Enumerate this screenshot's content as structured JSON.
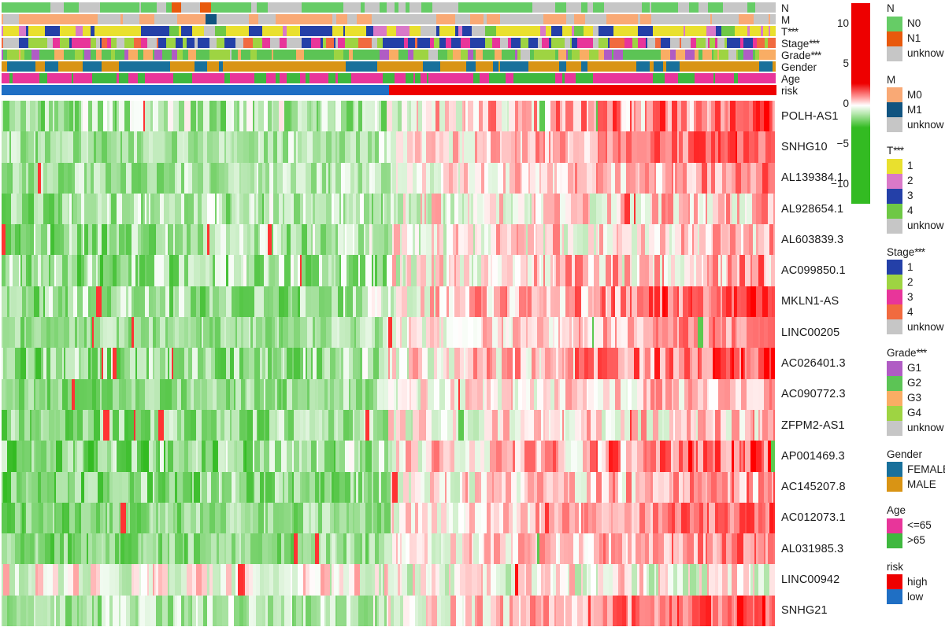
{
  "figure": {
    "type": "heatmap",
    "description": "Clustered expression heatmap of 17 lncRNAs across tumour samples with clinical annotation tracks and risk-group split"
  },
  "annotation_tracks": [
    {
      "name": "N",
      "label": "N",
      "stars": ""
    },
    {
      "name": "M",
      "label": "M",
      "stars": ""
    },
    {
      "name": "T",
      "label": "T",
      "stars": "***"
    },
    {
      "name": "Stage",
      "label": "Stage",
      "stars": "***"
    },
    {
      "name": "Grade",
      "label": "Grade",
      "stars": "***"
    },
    {
      "name": "Gender",
      "label": "Gender",
      "stars": ""
    },
    {
      "name": "Age",
      "label": "Age",
      "stars": ""
    },
    {
      "name": "risk",
      "label": "risk",
      "stars": ""
    }
  ],
  "row_labels": [
    "POLH-AS1",
    "SNHG10",
    "AL139384.1",
    "AL928654.1",
    "AL603839.3",
    "AC099850.1",
    "MKLN1-AS",
    "LINC00205",
    "AC026401.3",
    "AC090772.3",
    "ZFPM2-AS1",
    "AP001469.3",
    "AC145207.8",
    "AC012073.1",
    "AL031985.3",
    "LINC00942",
    "SNHG21"
  ],
  "colorbar": {
    "ticks": [
      "10",
      "5",
      "0",
      "-5",
      "-10"
    ],
    "tick_values": [
      10,
      5,
      0,
      -5,
      -10
    ],
    "min": -12.5,
    "max": 12.5,
    "high_color": "#ee0000",
    "mid_color": "#ffffff",
    "low_color": "#33bb22"
  },
  "legends": [
    {
      "title": "N",
      "stars": "",
      "items": [
        {
          "label": "N0",
          "color": "#66cc66"
        },
        {
          "label": "N1",
          "color": "#e8590c"
        },
        {
          "label": "unknow",
          "color": "#c6c6c6"
        }
      ]
    },
    {
      "title": "M",
      "stars": "",
      "items": [
        {
          "label": "M0",
          "color": "#f9a975"
        },
        {
          "label": "M1",
          "color": "#115480"
        },
        {
          "label": "unknow",
          "color": "#c6c6c6"
        }
      ]
    },
    {
      "title": "T",
      "stars": "***",
      "items": [
        {
          "label": "1",
          "color": "#e9e02e"
        },
        {
          "label": "2",
          "color": "#d979c8"
        },
        {
          "label": "3",
          "color": "#2440a8"
        },
        {
          "label": "4",
          "color": "#6ec845"
        },
        {
          "label": "unknow",
          "color": "#c6c6c6"
        }
      ]
    },
    {
      "title": "Stage",
      "stars": "***",
      "items": [
        {
          "label": "1",
          "color": "#2440a8"
        },
        {
          "label": "2",
          "color": "#9ed442"
        },
        {
          "label": "3",
          "color": "#e8359a"
        },
        {
          "label": "4",
          "color": "#f16a3f"
        },
        {
          "label": "unknow",
          "color": "#c6c6c6"
        }
      ]
    },
    {
      "title": "Grade",
      "stars": "***",
      "items": [
        {
          "label": "G1",
          "color": "#b05cc4"
        },
        {
          "label": "G2",
          "color": "#5cc455"
        },
        {
          "label": "G3",
          "color": "#f9ad64"
        },
        {
          "label": "G4",
          "color": "#9ed442"
        },
        {
          "label": "unknow",
          "color": "#c6c6c6"
        }
      ]
    },
    {
      "title": "Gender",
      "stars": "",
      "items": [
        {
          "label": "FEMALE",
          "color": "#18709b"
        },
        {
          "label": "MALE",
          "color": "#d99414"
        }
      ]
    },
    {
      "title": "Age",
      "stars": "",
      "items": [
        {
          "label": "<=65",
          "color": "#e8359a"
        },
        {
          "label": ">65",
          "color": "#3fb83f"
        }
      ]
    },
    {
      "title": "risk",
      "stars": "",
      "items": [
        {
          "label": "high",
          "color": "#ee0000"
        },
        {
          "label": "low",
          "color": "#1f6fc4"
        }
      ]
    }
  ],
  "chart_data": {
    "type": "heatmap",
    "n_rows": 17,
    "n_columns": 410,
    "risk_split_column": 205,
    "row_order": [
      "POLH-AS1",
      "SNHG10",
      "AL139384.1",
      "AL928654.1",
      "AL603839.3",
      "AC099850.1",
      "MKLN1-AS",
      "LINC00205",
      "AC026401.3",
      "AC090772.3",
      "ZFPM2-AS1",
      "AP001469.3",
      "AC145207.8",
      "AC012073.1",
      "AL031985.3",
      "LINC00942",
      "SNHG21"
    ],
    "value_range": [
      -12.5,
      12.5
    ],
    "colormap": "green-white-red",
    "legend_position": "right",
    "grid": false,
    "note": "Left half of columns = low-risk group (blue risk bar), right half = high-risk group (red risk bar). Low-risk samples are predominantly green (down-regulated), high-risk samples predominantly red (up-regulated)."
  }
}
